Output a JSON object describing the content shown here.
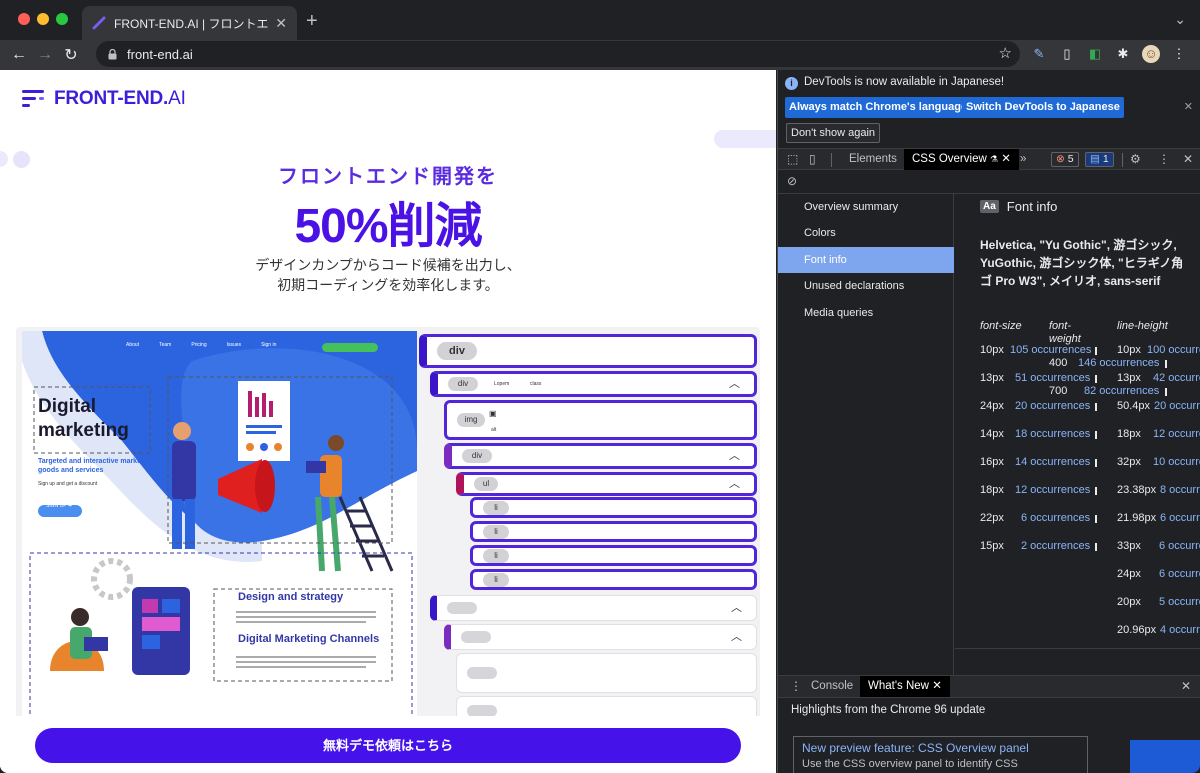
{
  "browser": {
    "tab_title": "FRONT-END.AI | フロントエンド",
    "tab_close": "✕",
    "new_tab": "+",
    "url": "front-end.ai"
  },
  "page": {
    "logo_bold": "FRONT-END.",
    "logo_light": "AI",
    "hero_subtitle": "フロントエンド開発を",
    "hero_title": "50%削減",
    "hero_desc_line1": "デザインカンプからコード候補を出力し、",
    "hero_desc_line2": "初期コーディングを効率化します。",
    "cta_label": "無料デモ依頼はこちら",
    "mock": {
      "nav": [
        "About",
        "Team",
        "Pricing",
        "Issues",
        "Sign in"
      ],
      "heading_line1": "Digital",
      "heading_line2": "marketing",
      "tagline": "Targeted and interactive marketing of goods and services",
      "signup_text": "Sign up and get a discount",
      "signup_btn": "SIGN UP ➔",
      "card_title1": "Design and strategy",
      "card_title2": "Digital Marketing Channels"
    },
    "tree": {
      "root": "div",
      "child1": "div",
      "child1_attr1": "Lopem",
      "child1_attr2": "class",
      "img": "img",
      "img_attr": "alt",
      "div2": "div",
      "ul": "ul",
      "li": "li"
    }
  },
  "devtools": {
    "info_message": "DevTools is now available in Japanese!",
    "btn_match": "Always match Chrome's language",
    "btn_switch": "Switch DevTools to Japanese",
    "btn_dont_show": "Don't show again",
    "tab_elements": "Elements",
    "tab_css_overview": "CSS Overview",
    "more_tabs": "»",
    "error_count": "5",
    "message_count": "1",
    "nav_items": [
      "Overview summary",
      "Colors",
      "Font info",
      "Unused declarations",
      "Media queries"
    ],
    "selected_nav": "Font info",
    "font_info": {
      "title": "Font info",
      "aa": "Aa",
      "family": "Helvetica, \"Yu Gothic\", 游ゴシック, YuGothic, 游ゴシック体, \"ヒラギノ角ゴ Pro W3\", メイリオ, sans-serif",
      "col_size": "font-size",
      "col_weight": "font-weight",
      "col_lineheight": "line-height",
      "sizes": [
        {
          "value": "10px",
          "occ": "105 occurrences"
        },
        {
          "value": "13px",
          "occ": "51 occurrences"
        },
        {
          "value": "24px",
          "occ": "20 occurrences"
        },
        {
          "value": "14px",
          "occ": "18 occurrences"
        },
        {
          "value": "16px",
          "occ": "14 occurrences"
        },
        {
          "value": "18px",
          "occ": "12 occurrences"
        },
        {
          "value": "22px",
          "occ": "6 occurrences"
        },
        {
          "value": "15px",
          "occ": "2 occurrences"
        }
      ],
      "weights": [
        {
          "value": "400",
          "occ": "146 occurrences"
        },
        {
          "value": "700",
          "occ": "82 occurrences"
        }
      ],
      "lineheights": [
        {
          "value": "10px",
          "occ": "100 occurre"
        },
        {
          "value": "13px",
          "occ": "42 occurre"
        },
        {
          "value": "50.4px",
          "occ": "20 occurre"
        },
        {
          "value": "18px",
          "occ": "12 occurre"
        },
        {
          "value": "32px",
          "occ": "10 occurre"
        },
        {
          "value": "23.38px",
          "occ": "8 occurre"
        },
        {
          "value": "21.98px",
          "occ": "6 occurre"
        },
        {
          "value": "33px",
          "occ": "6 occurre"
        },
        {
          "value": "24px",
          "occ": "6 occurre"
        },
        {
          "value": "20px",
          "occ": "5 occurre"
        },
        {
          "value": "20.96px",
          "occ": "4 occurre"
        }
      ]
    },
    "drawer": {
      "tab_console": "Console",
      "tab_whats_new": "What's New",
      "highlights": "Highlights from the Chrome 96 update",
      "card_title": "New preview feature: CSS Overview panel",
      "card_desc": "Use the CSS overview panel to identify CSS improvements on your page"
    }
  },
  "colors": {
    "brand": "#4512ea",
    "link": "#8ab4f8",
    "selected": "#7ea6ee"
  }
}
